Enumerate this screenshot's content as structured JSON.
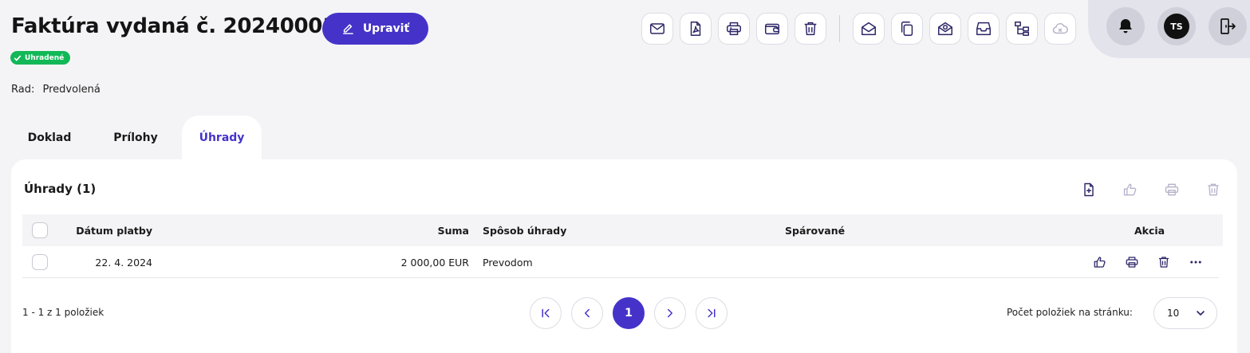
{
  "header": {
    "title": "Faktúra vydaná č. 20240001",
    "edit_label": "Upraviť",
    "status_badge": "Uhradené",
    "rad_label": "Rad:",
    "rad_value": "Predvolená"
  },
  "toolbar": {
    "icons": [
      "mail-icon",
      "pdf-icon",
      "print-icon",
      "wallet-icon",
      "trash-icon",
      "open-mail-icon",
      "copy-icon",
      "mail-badge-icon",
      "archive-icon",
      "tree-icon",
      "cloud-icon"
    ]
  },
  "user": {
    "initials": "TS"
  },
  "tabs": [
    {
      "label": "Doklad",
      "active": false
    },
    {
      "label": "Prílohy",
      "active": false
    },
    {
      "label": "Úhrady",
      "active": true
    }
  ],
  "payments": {
    "title": "Úhrady (1)",
    "columns": {
      "date": "Dátum platby",
      "sum": "Suma",
      "method": "Spôsob úhrady",
      "matched": "Spárované",
      "actions": "Akcia"
    },
    "rows": [
      {
        "date": "22. 4. 2024",
        "sum": "2 000,00 EUR",
        "method": "Prevodom",
        "matched": ""
      }
    ]
  },
  "pagination": {
    "info": "1 - 1 z 1 položiek",
    "current_page": "1",
    "per_page_label": "Počet položiek na stránku:",
    "per_page_value": "10"
  },
  "colors": {
    "accent": "#4533c9",
    "success": "#12b857",
    "background": "#f4f4f6"
  }
}
